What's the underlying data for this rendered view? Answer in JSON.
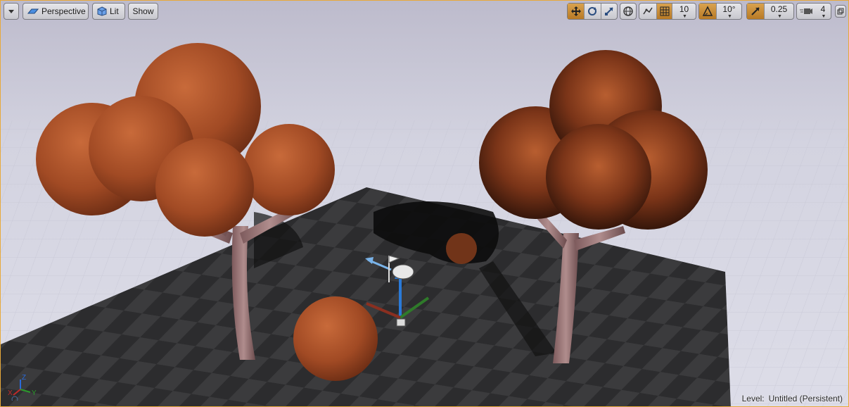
{
  "toolbar": {
    "menu_icon": "chevron-down-icon",
    "perspective_label": "Perspective",
    "lit_label": "Lit",
    "show_label": "Show",
    "grid_snap_value": "10",
    "rotation_snap_value": "10°",
    "scale_snap_value": "0.25",
    "camera_speed_value": "4",
    "accent_color": "#c98f35"
  },
  "status": {
    "level_label": "Level:",
    "level_name": "Untitled (Persistent)"
  },
  "axes": {
    "x_label": "X",
    "y_label": "Y",
    "z_label": "Z"
  }
}
